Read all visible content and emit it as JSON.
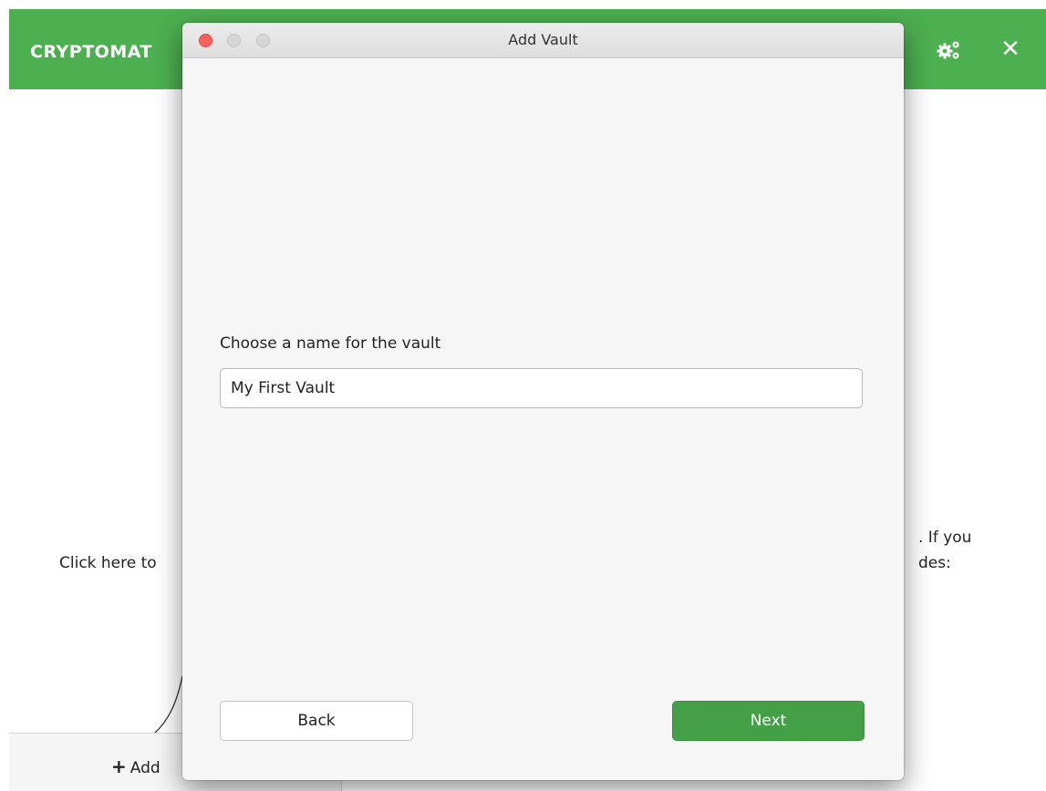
{
  "app": {
    "title": "CRYPTOMAT",
    "header_icons": [
      "gear-icon",
      "close-icon"
    ],
    "close_glyph": "✕",
    "body_left_text": "Click here to",
    "body_right_line1": ". If you",
    "body_right_line2": "des:",
    "add_button_label": "Add",
    "accent_color": "#4caf50"
  },
  "dialog": {
    "title": "Add Vault",
    "name_label": "Choose a name for the vault",
    "name_value": "My First Vault",
    "back_label": "Back",
    "next_label": "Next",
    "next_color": "#43a047"
  }
}
